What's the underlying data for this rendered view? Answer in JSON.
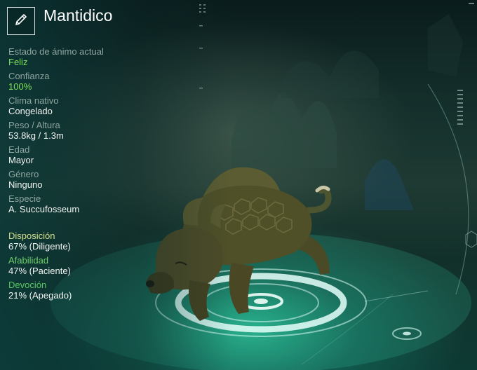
{
  "creature": {
    "name": "Mantidico",
    "edit_icon": "pencil-icon"
  },
  "stats": [
    {
      "label": "Estado de ánimo actual",
      "value": "Feliz",
      "value_color": "#7ee05a"
    },
    {
      "label": "Confianza",
      "value": "100%",
      "value_color": "#7ee05a"
    },
    {
      "label": "Clima nativo",
      "value": "Congelado"
    },
    {
      "label": "Peso / Altura",
      "value": "53.8kg / 1.3m"
    },
    {
      "label": "Edad",
      "value": "Mayor"
    },
    {
      "label": "Género",
      "value": "Ninguno"
    },
    {
      "label": "Especie",
      "value": "A. Succufosseum"
    }
  ],
  "traits": [
    {
      "label": "Disposición",
      "value": "67% (Diligente)",
      "label_color": "#d6e08a"
    },
    {
      "label": "Afabilidad",
      "value": "47% (Paciente)",
      "label_color": "#6fd06a"
    },
    {
      "label": "Devoción",
      "value": "21% (Apegado)",
      "label_color": "#57c95c"
    }
  ],
  "colors": {
    "accent_green": "#7ee05a",
    "platform_glow": "#3fd0a8"
  }
}
